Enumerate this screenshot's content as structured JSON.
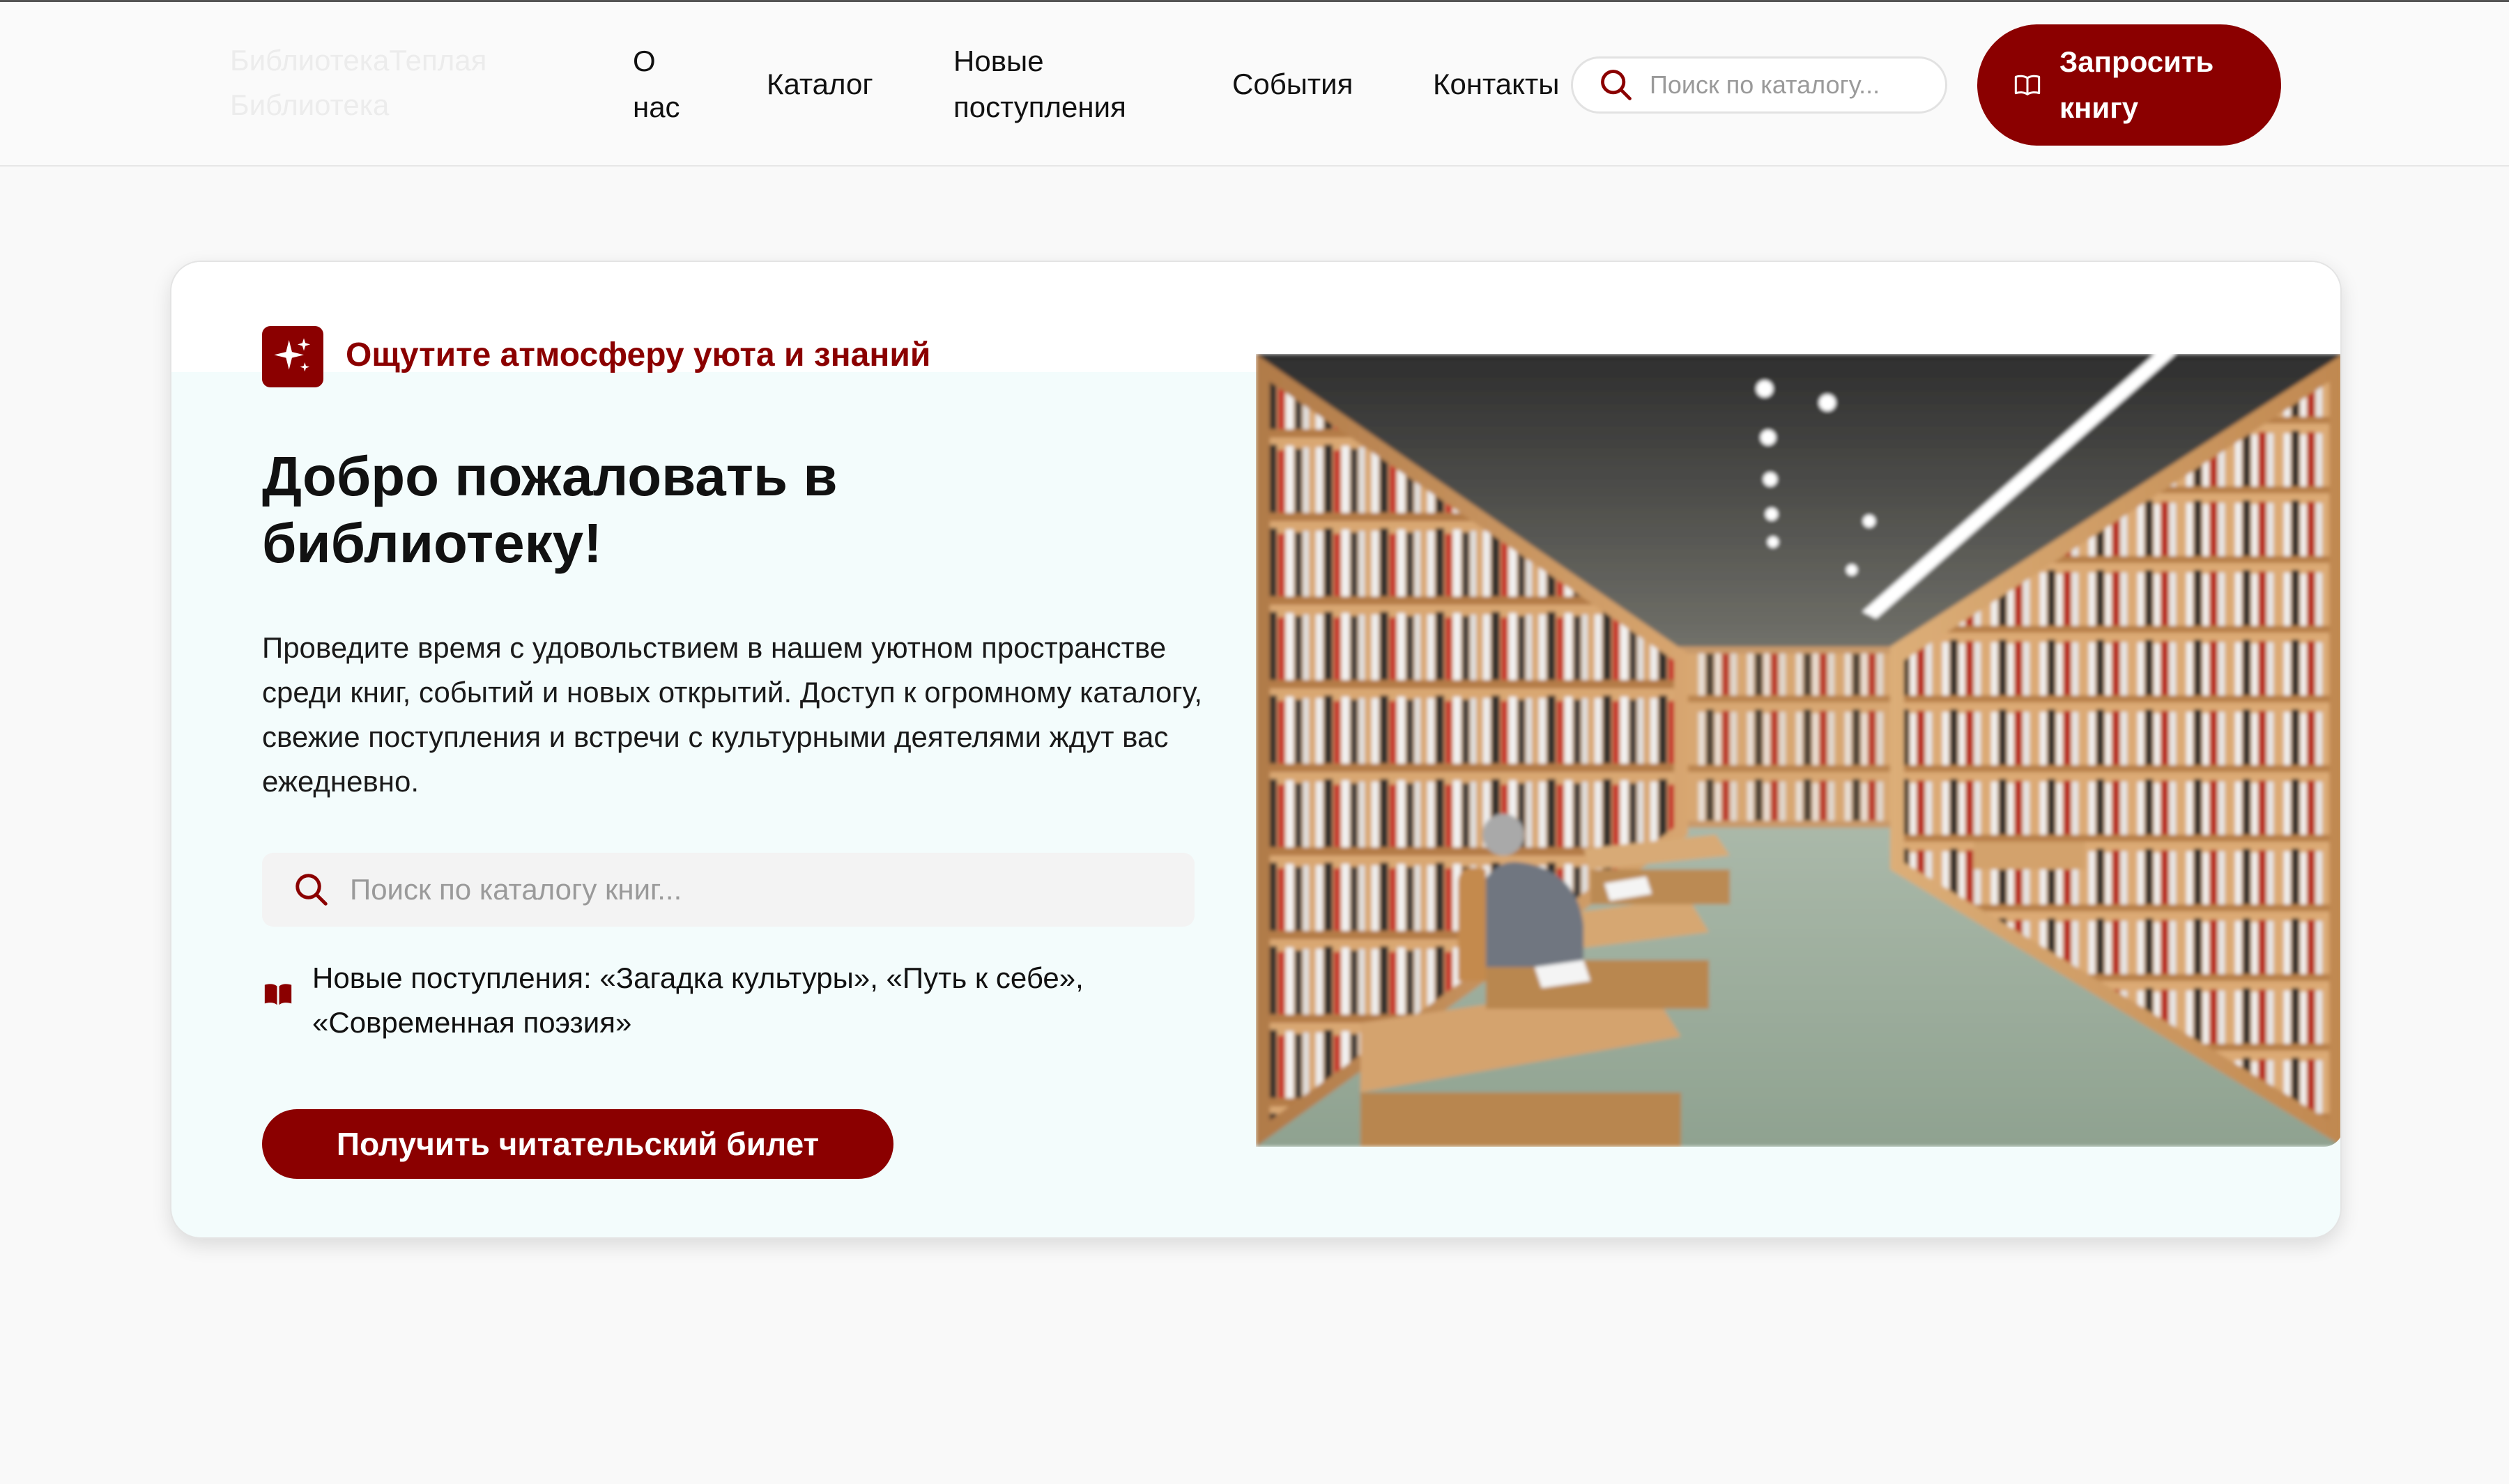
{
  "header": {
    "logo_text": "БиблиотекаТеплая Библиотека",
    "nav": [
      {
        "label": "О нас"
      },
      {
        "label": "Каталог"
      },
      {
        "label": "Новые поступления"
      },
      {
        "label": "События"
      },
      {
        "label": "Контакты"
      }
    ],
    "search": {
      "placeholder": "Поиск по каталогу..."
    },
    "request_button": {
      "label": "Запросить книгу",
      "icon": "book-open-icon"
    }
  },
  "hero": {
    "tagline": "Ощутите атмосферу уюта и знаний",
    "tagline_icon": "sparkles-icon",
    "title": "Добро пожаловать в библиотеку!",
    "description": "Проведите время с удовольствием в нашем уютном пространстве среди книг, событий и новых открытий. Доступ к огромному каталогу, свежие поступления и встречи с культурными деятелями ждут вас ежедневно.",
    "search": {
      "placeholder": "Поиск по каталогу книг..."
    },
    "new_arrivals": "Новые поступления: «Загадка культуры», «Путь к себе», «Современная поэзия»",
    "new_arrivals_icon": "book-icon",
    "ticket_button": "Получить читательский билет",
    "image": "library-interior-photo"
  },
  "colors": {
    "accent": "#8b0000",
    "card_background": "#f3fcfc",
    "page_background": "#f9f9f9"
  }
}
